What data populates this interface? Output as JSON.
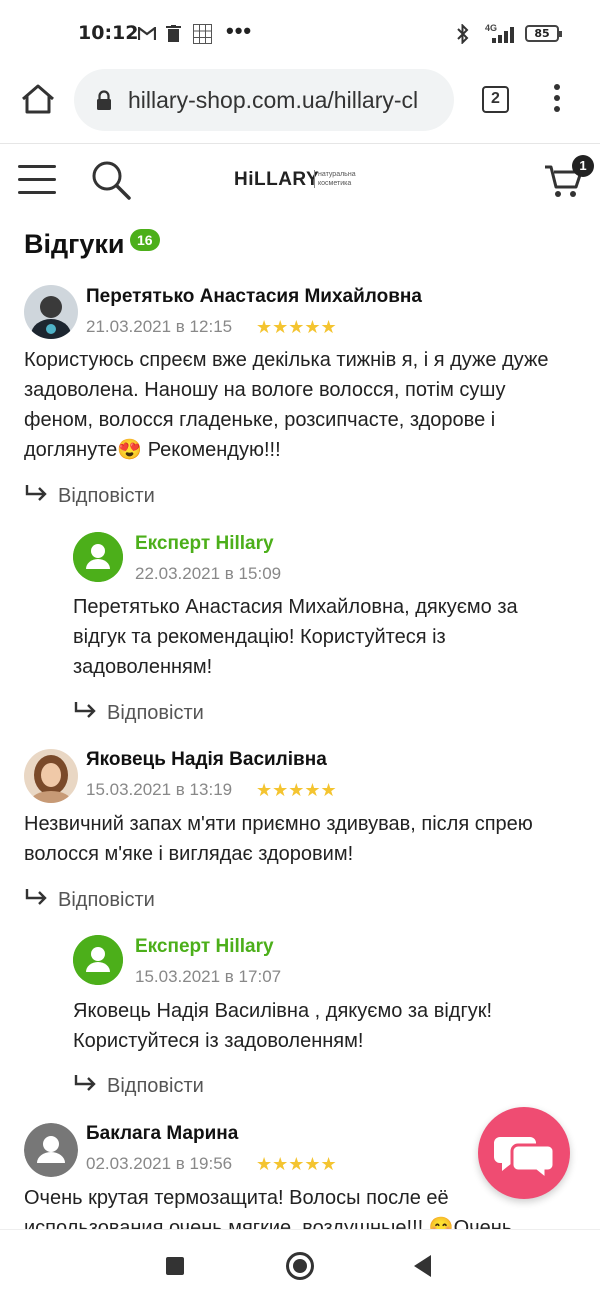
{
  "status_bar": {
    "time": "10:12",
    "icons": [
      "gmail-icon",
      "trash-icon",
      "sudoku-icon",
      "more-icon",
      "bluetooth-icon",
      "signal-4g-icon"
    ],
    "dots": "•••",
    "network": "4G",
    "battery": "85"
  },
  "browser": {
    "url": "hillary-shop.com.ua/hillary-cl",
    "tabs_count": "2"
  },
  "site_header": {
    "logo_text": "HiLLARY",
    "logo_tagline": "натуральна косметика",
    "cart_count": "1"
  },
  "reviews": {
    "title": "Відгуки",
    "count": "16",
    "reply_label": "Відповісти",
    "items": [
      {
        "author": "Перетятько Анастасия Михайловна",
        "date": "21.03.2021 в 12:15",
        "stars": "★★★★★",
        "rating": 5,
        "text": "Користуюсь спреєм вже декілька тижнів я, і я дуже дуже задоволена. Наношу на вологе волосся, потім сушу феном, волосся гладеньке, розсипчасте, здорове і доглянуте😍 Рекомендую!!!",
        "reply_label": "Відповісти",
        "expert": {
          "name": "Експерт Hillary",
          "date": "22.03.2021 в 15:09",
          "text": "Перетятько Анастасия Михайловна, дякуємо за відгук та рекомендацію! Користуйтеся із задоволенням!",
          "reply_label": "Відповісти"
        }
      },
      {
        "author": "Яковець Надія Василівна",
        "date": "15.03.2021 в 13:19",
        "stars": "★★★★★",
        "rating": 5,
        "text": "Незвичний запах м'яти приємно здивував, після спрею волосся м'яке і виглядає здоровим!",
        "reply_label": "Відповісти",
        "expert": {
          "name": "Експерт Hillary",
          "date": "15.03.2021 в 17:07",
          "text": "Яковець Надія Василівна , дякуємо за відгук! Користуйтеся із задоволенням!",
          "reply_label": "Відповісти"
        }
      },
      {
        "author": "Баклага Марина",
        "date": "02.03.2021 в 19:56",
        "stars": "★★★★★",
        "rating": 5,
        "text": "Очень крутая термозащита! Волосы после её использования очень мягкие, воздушные!!! 😊Очень"
      }
    ]
  },
  "colors": {
    "accent_green": "#4caf1a",
    "star_yellow": "#f4c430",
    "chat_pink": "#ef4c72"
  }
}
